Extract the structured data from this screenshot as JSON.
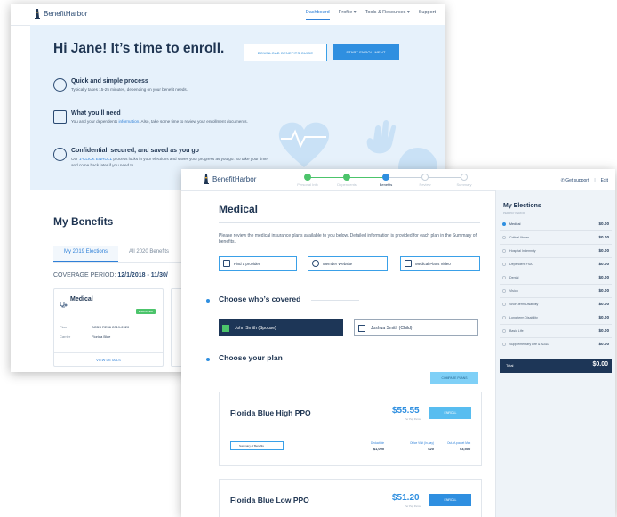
{
  "colors": {
    "accent": "#2f8fe0",
    "navy": "#1d3657",
    "success": "#4cc46b",
    "hero_bg": "#e6f1fb"
  },
  "back": {
    "logo": "BenefitHarbor",
    "nav": {
      "dashboard": "Dashboard",
      "profile": "Profile ▾",
      "tools": "Tools & Resources ▾",
      "support": "Support"
    },
    "hero": {
      "title": "Hi Jane! It’s time to enroll.",
      "download": "DOWNLOAD BENEFITS GUIDE",
      "start": "START ENROLLMENT",
      "f1_title": "Quick and simple process",
      "f1_desc": "Typically takes 15-25 minutes, depending on your benefit needs.",
      "f2_title": "What you’ll need",
      "f2_desc_a": "You and your dependents ",
      "f2_link": "information",
      "f2_desc_b": ". Also, take some time to review your enrollment documents.",
      "f3_title": "Confidential, secured, and saved as you go",
      "f3_desc_a": "Our ",
      "f3_link": "1-CLICK ENROLL",
      "f3_desc_b": " process locks in your elections and saves your progress as you go. So take your time, and come back later if you need to."
    },
    "my_benefits": "My Benefits",
    "tab_2019": "My 2019 Elections",
    "tab_2020": "All 2020 Benefits",
    "coverage_label": "COVERAGE PERIOD:",
    "coverage_value": "12/1/2018 - 11/30/",
    "card": {
      "title": "Medical",
      "badge": "ENROLLED",
      "plan_label": "Plan",
      "plan_value": "BCBS RE36 2019-2020",
      "carrier_label": "Carrier",
      "carrier_value": "Florida Blue",
      "view": "VIEW DETAILS"
    }
  },
  "front": {
    "logo": "BenefitHarbor",
    "steps": [
      "Personal Info",
      "Dependents",
      "Benefits",
      "Review",
      "Summary"
    ],
    "get_support": "Get support",
    "exit": "Exit",
    "title": "Medical",
    "intro": "Please review the medical insurance plans available to you below.  Detailed information is provided for each plan in the Summary of benefits.",
    "links": [
      "Find a provider",
      "Member Website",
      "Medical Plans Video"
    ],
    "choose_covered": "Choose who’s covered",
    "people": [
      "John Smith (Spouse)",
      "Joshua Smith (Child)"
    ],
    "choose_plan": "Choose your plan",
    "compare": "COMPARE PLANS",
    "plans": [
      {
        "name": "Florida Blue High PPO",
        "price": "$55.55",
        "per": "Per Pay Period",
        "enroll": "ENROLL",
        "sob": "Summary of Benefits",
        "deductible_label": "Deductible",
        "deductible": "$1,000",
        "office_label": "Office Visit (In-pay)",
        "office": "$20",
        "oop_label": "Out-of-pocket Max",
        "oop": "$3,500"
      },
      {
        "name": "Florida Blue Low PPO",
        "price": "$51.20",
        "per": "Per Pay Period",
        "enroll": "ENROLL"
      }
    ],
    "sidebar": {
      "title": "My Elections",
      "subtitle": "PER PAY PERIOD",
      "items": [
        {
          "name": "Medical",
          "amount": "$0.00"
        },
        {
          "name": "Critical Illness",
          "amount": "$0.00"
        },
        {
          "name": "Hospital Indemnity",
          "amount": "$0.00"
        },
        {
          "name": "Dependent FSA",
          "amount": "$0.00"
        },
        {
          "name": "Dental",
          "amount": "$0.00"
        },
        {
          "name": "Vision",
          "amount": "$0.00"
        },
        {
          "name": "Short-term Disability",
          "amount": "$0.00"
        },
        {
          "name": "Long-term Disability",
          "amount": "$0.00"
        },
        {
          "name": "Basic Life",
          "amount": "$0.00"
        },
        {
          "name": "Supplementary Life & AD&D",
          "amount": "$0.00"
        }
      ],
      "total_label": "Total",
      "total_value": "$0.00"
    }
  }
}
